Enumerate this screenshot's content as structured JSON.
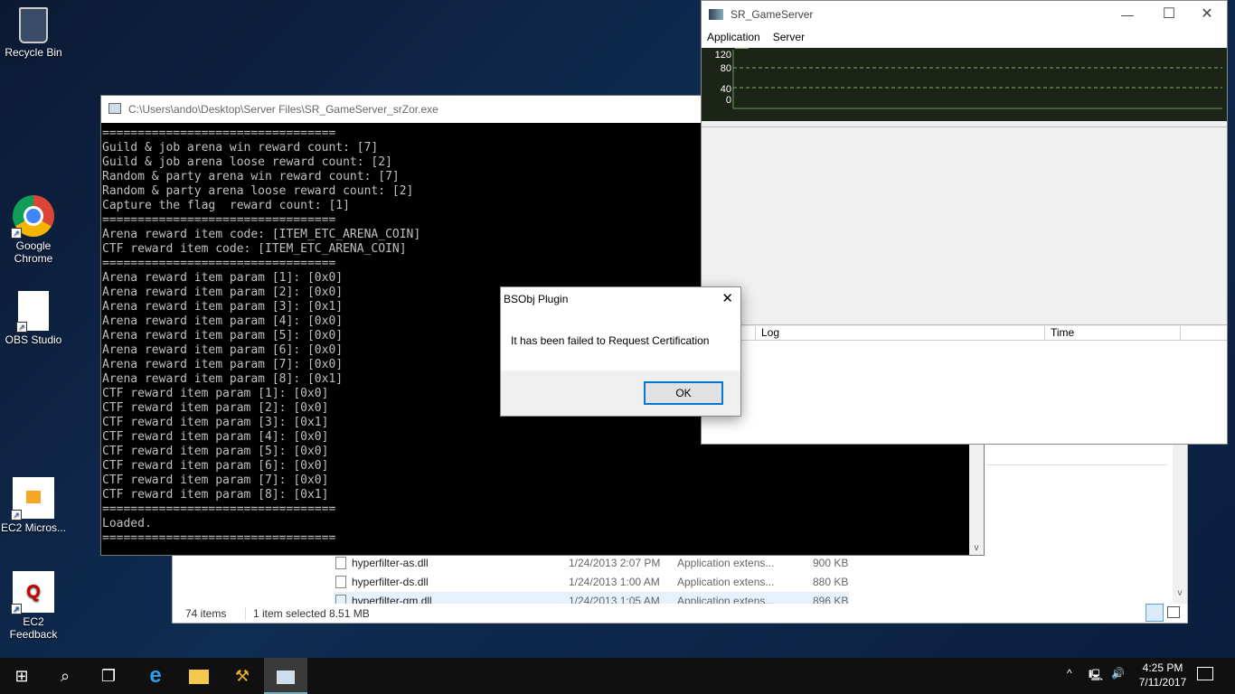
{
  "desktop": {
    "icons": [
      {
        "label": "Recycle Bin"
      },
      {
        "label": "Google Chrome"
      },
      {
        "label": "OBS Studio"
      },
      {
        "label": "EC2 Micros..."
      },
      {
        "label": "EC2 Feedback"
      }
    ]
  },
  "console": {
    "title": "C:\\Users\\ando\\Desktop\\Server Files\\SR_GameServer_srZor.exe",
    "lines": [
      "=================================",
      "Guild & job arena win reward count: [7]",
      "Guild & job arena loose reward count: [2]",
      "Random & party arena win reward count: [7]",
      "Random & party arena loose reward count: [2]",
      "Capture the flag  reward count: [1]",
      "=================================",
      "Arena reward item code: [ITEM_ETC_ARENA_COIN]",
      "CTF reward item code: [ITEM_ETC_ARENA_COIN]",
      "=================================",
      "Arena reward item param [1]: [0x0]",
      "Arena reward item param [2]: [0x0]",
      "Arena reward item param [3]: [0x1]",
      "Arena reward item param [4]: [0x0]",
      "Arena reward item param [5]: [0x0]",
      "Arena reward item param [6]: [0x0]",
      "Arena reward item param [7]: [0x0]",
      "Arena reward item param [8]: [0x1]",
      "CTF reward item param [1]: [0x0]",
      "CTF reward item param [2]: [0x0]",
      "CTF reward item param [3]: [0x1]",
      "CTF reward item param [4]: [0x0]",
      "CTF reward item param [5]: [0x0]",
      "CTF reward item param [6]: [0x0]",
      "CTF reward item param [7]: [0x0]",
      "CTF reward item param [8]: [0x1]",
      "=================================",
      "Loaded.",
      "================================="
    ]
  },
  "explorer": {
    "files": [
      {
        "name": "hyperfilter-as.dll",
        "date": "1/24/2013 2:07 PM",
        "type": "Application extens...",
        "size": "900 KB"
      },
      {
        "name": "hyperfilter-ds.dll",
        "date": "1/24/2013 1:00 AM",
        "type": "Application extens...",
        "size": "880 KB"
      },
      {
        "name": "hyperfilter-gm.dll",
        "date": "1/24/2013 1:05 AM",
        "type": "Application extens...",
        "size": "896 KB"
      }
    ],
    "item_count": "74 items",
    "selection": "1 item selected  8.51 MB"
  },
  "gameserver": {
    "title": "SR_GameServer",
    "menu": [
      "Application",
      "Server"
    ],
    "chart_ticks": [
      "120",
      "80",
      "40",
      "0"
    ],
    "log_columns": [
      "",
      "Log",
      "Time"
    ]
  },
  "dialog": {
    "title": "BSObj Plugin",
    "message": "It has been failed to Request Certification",
    "ok": "OK"
  },
  "taskbar": {
    "time": "4:25 PM",
    "date": "7/11/2017"
  }
}
